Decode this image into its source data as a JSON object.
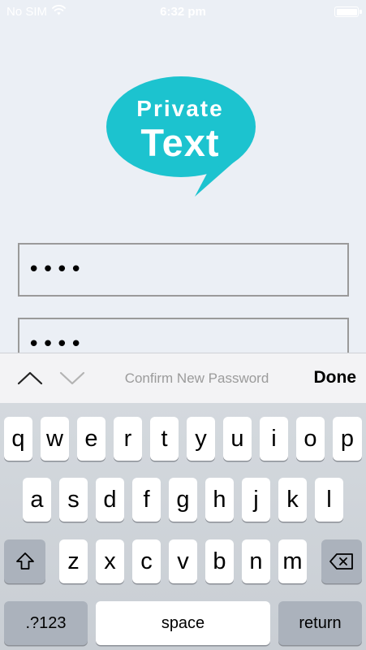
{
  "status_bar": {
    "carrier": "No SIM",
    "time": "6:32 pm"
  },
  "logo": {
    "line1": "Private",
    "line2": "Text",
    "bubble_color": "#1cc3cf"
  },
  "fields": [
    {
      "value": "••••"
    },
    {
      "value": "••••"
    }
  ],
  "accessory_bar": {
    "title": "Confirm New Password",
    "done_label": "Done"
  },
  "keyboard": {
    "row1": [
      "q",
      "w",
      "e",
      "r",
      "t",
      "y",
      "u",
      "i",
      "o",
      "p"
    ],
    "row2": [
      "a",
      "s",
      "d",
      "f",
      "g",
      "h",
      "j",
      "k",
      "l"
    ],
    "row3": [
      "z",
      "x",
      "c",
      "v",
      "b",
      "n",
      "m"
    ],
    "mode_label": ".?123",
    "space_label": "space",
    "return_label": "return"
  }
}
